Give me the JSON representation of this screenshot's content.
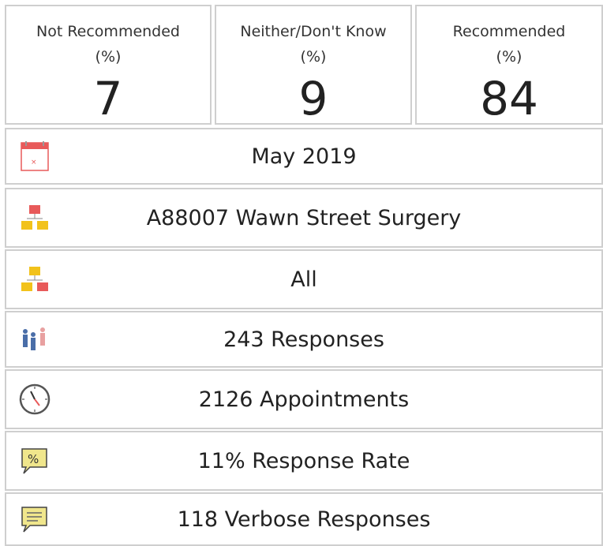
{
  "stats": [
    {
      "label_line1": "Not Recommended",
      "label_line2": "(%)",
      "value": "7"
    },
    {
      "label_line1": "Neither/Don't Know",
      "label_line2": "(%)",
      "value": "9"
    },
    {
      "label_line1": "Recommended",
      "label_line2": "(%)",
      "value": "84"
    }
  ],
  "rows": {
    "period": {
      "text": "May 2019",
      "icon": "calendar-icon"
    },
    "practice": {
      "text": "A88007 Wawn Street Surgery",
      "icon": "org-chart-icon"
    },
    "scope": {
      "text": "All",
      "icon": "org-chart-icon"
    },
    "responses": {
      "text": "243 Responses",
      "icon": "people-icon"
    },
    "appointments": {
      "text": "2126 Appointments",
      "icon": "clock-icon"
    },
    "response_rate": {
      "text": "11% Response Rate",
      "icon": "percent-bubble-icon"
    },
    "verbose": {
      "text": "118 Verbose Responses",
      "icon": "comment-bubble-icon"
    }
  },
  "colors": {
    "border": "#cfcfcf",
    "icon_red": "#e85a5a",
    "icon_yellow": "#f2c21b",
    "icon_blue": "#4a6ea8",
    "icon_bubble": "#f0e68c"
  }
}
